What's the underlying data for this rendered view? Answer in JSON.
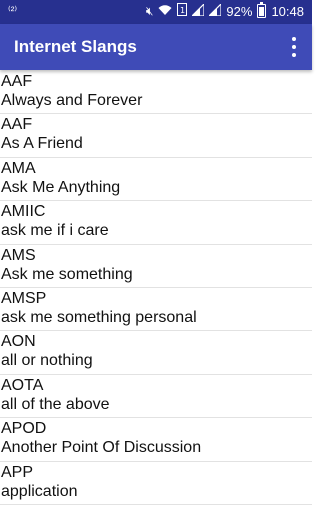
{
  "status_bar": {
    "left_indicator": "⁽²⁾",
    "battery_percent": "92%",
    "time": "10:48",
    "icons": [
      "mute-icon",
      "wifi-icon",
      "sim1-icon",
      "signal-icon",
      "signal-icon-2",
      "battery-icon"
    ]
  },
  "app_bar": {
    "title": "Internet Slangs",
    "menu_icon": "overflow-menu-icon"
  },
  "colors": {
    "status_bar": "#27308f",
    "app_bar": "#3f4bb7",
    "divider": "#e2e2e2"
  },
  "items": [
    {
      "abbr": "AAF",
      "meaning": "Always and Forever"
    },
    {
      "abbr": "AAF",
      "meaning": "As A Friend"
    },
    {
      "abbr": "AMA",
      "meaning": "Ask Me Anything"
    },
    {
      "abbr": "AMIIC",
      "meaning": "ask me if i care"
    },
    {
      "abbr": "AMS",
      "meaning": "Ask me something"
    },
    {
      "abbr": "AMSP",
      "meaning": "ask me something personal"
    },
    {
      "abbr": "AON",
      "meaning": "all or nothing"
    },
    {
      "abbr": "AOTA",
      "meaning": "all of the above"
    },
    {
      "abbr": "APOD",
      "meaning": "Another Point Of Discussion"
    },
    {
      "abbr": "APP",
      "meaning": "application"
    }
  ]
}
